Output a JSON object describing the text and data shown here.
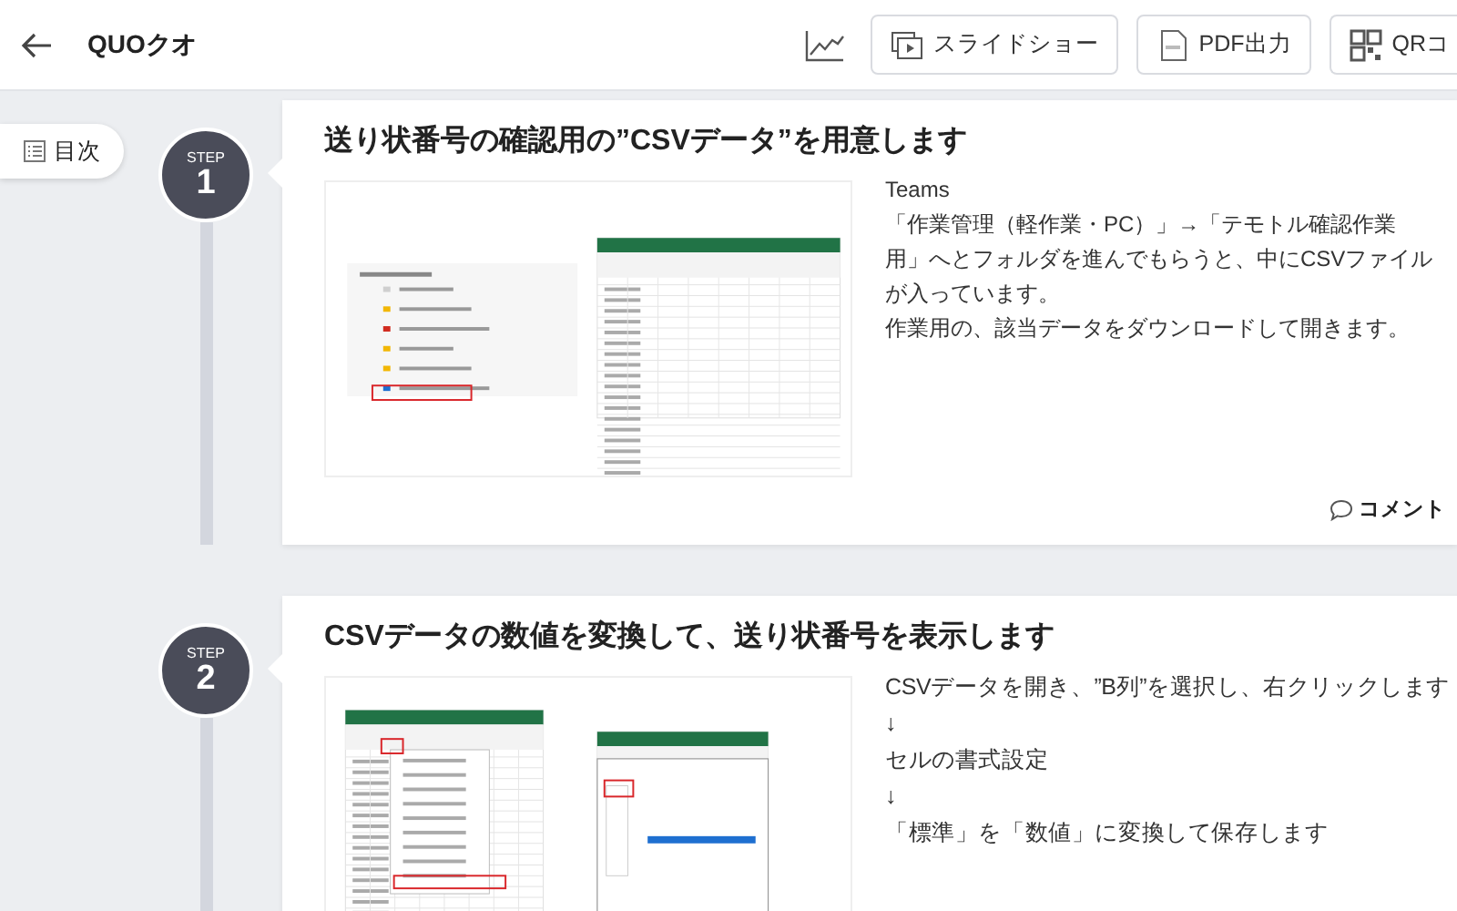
{
  "header": {
    "title": "QUOクオ",
    "buttons": [
      {
        "kind": "slideshow",
        "label": "スライドショー"
      },
      {
        "kind": "pdf",
        "label": "PDF出力"
      },
      {
        "kind": "qr",
        "label": "QRコ"
      }
    ]
  },
  "toc": {
    "label": "目次"
  },
  "steps": [
    {
      "step_label": "STEP",
      "number": "1",
      "title": "送り状番号の確認用の”CSVデータ”を用意します",
      "kind": "explorer_sheet",
      "lines": [
        "Teams",
        "「作業管理（軽作業・PC）」→「テモトル確認作業用」へとフォルダを進んでもらうと、中にCSVファイルが入っています。",
        "作業用の、該当データをダウンロードして開きます。"
      ],
      "comment": "コメント"
    },
    {
      "step_label": "STEP",
      "number": "2",
      "title": "CSVデータの数値を変換して、送り状番号を表示します",
      "kind": "sheet_dialog",
      "lines": [
        "CSVデータを開き、”B列”を選択し、右クリックします",
        "↓",
        "セルの書式設定",
        "↓",
        "「標準」を「数値」に変換して保存します"
      ]
    }
  ]
}
